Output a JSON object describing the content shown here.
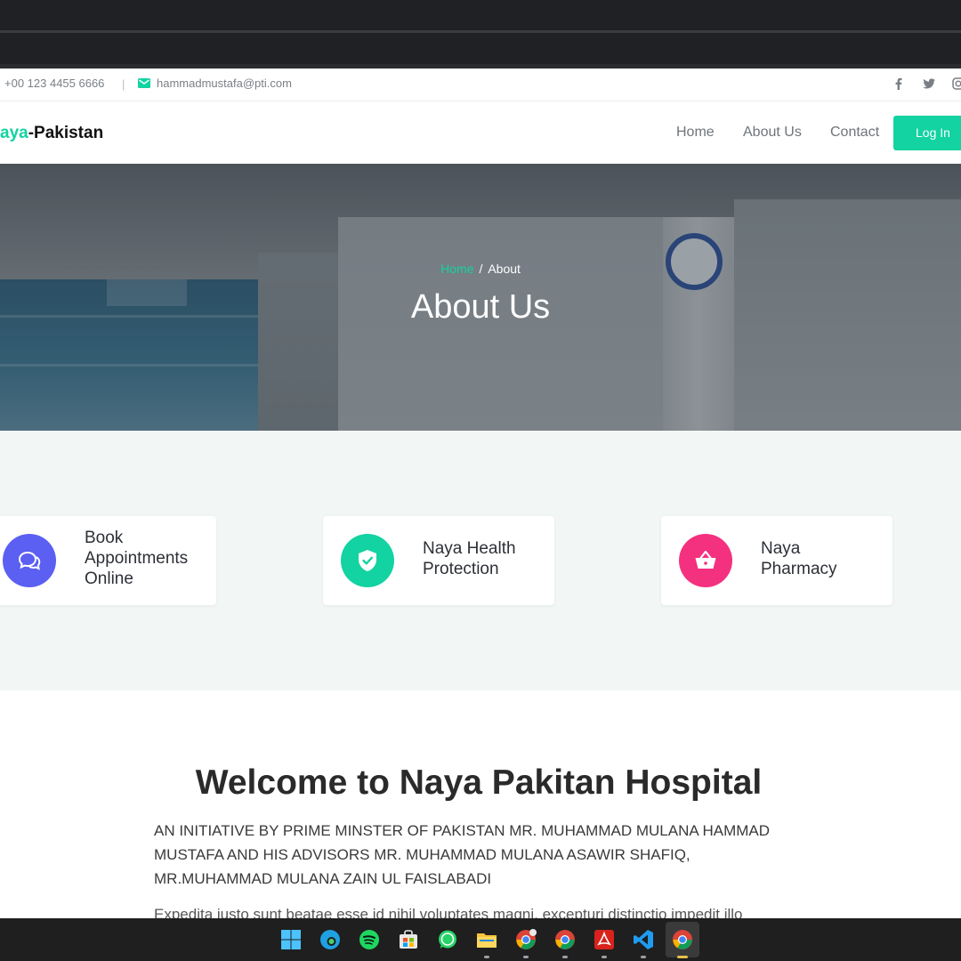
{
  "topbar": {
    "phone": "+00 123 4455 6666",
    "separator": "|",
    "email": "hammadmustafa@pti.com",
    "icons": [
      "mail-icon",
      "facebook-icon",
      "twitter-icon",
      "instagram-icon"
    ]
  },
  "navbar": {
    "brand_accent": "aya",
    "brand_rest": "-Pakistan",
    "links": [
      "Home",
      "About Us",
      "Contact"
    ],
    "login_label": "Log In"
  },
  "hero": {
    "breadcrumb_home": "Home",
    "breadcrumb_sep": "/",
    "breadcrumb_current": "About",
    "title": "About Us"
  },
  "features": [
    {
      "line1": "Book",
      "line2": "Appointments",
      "line3": "Online",
      "icon": "chat-icon",
      "color": "#5b5ff2"
    },
    {
      "line1": "Naya Health",
      "line2": "Protection",
      "icon": "shield-check-icon",
      "color": "#12d3a1"
    },
    {
      "line1": "Naya",
      "line2": "Pharmacy",
      "icon": "basket-icon",
      "color": "#f4317e"
    }
  ],
  "welcome": {
    "title": "Welcome to Naya Pakitan Hospital",
    "subtitle": "AN INITIATIVE BY PRIME MINSTER OF PAKISTAN MR. MUHAMMAD MULANA HAMMAD MUSTAFA AND HIS ADVISORS MR. MUHAMMAD MULANA ASAWIR SHAFIQ, MR.MUHAMMAD MULANA ZAIN UL FAISLABADI",
    "body": "Expedita iusto sunt beatae esse id nihil voluptates magni, excepturi distinctio impedit illo"
  },
  "colors": {
    "accent": "#12d3a1",
    "chrome": "#202124",
    "section_bg": "#f2f7f5"
  },
  "taskbar": {
    "icons": [
      "windows-start-icon",
      "edge-icon",
      "spotify-icon",
      "store-icon",
      "whatsapp-icon",
      "file-explorer-icon",
      "chrome-profile-icon",
      "chrome-icon",
      "acrobat-icon",
      "vscode-icon",
      "chrome-active-icon"
    ]
  }
}
